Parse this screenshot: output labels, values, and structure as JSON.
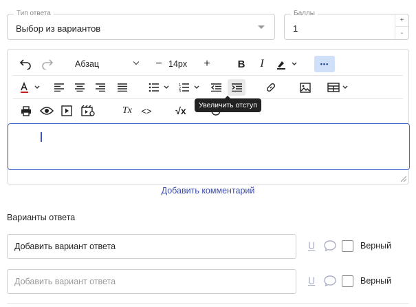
{
  "answer_type": {
    "legend": "Тип ответа",
    "value": "Выбор из вариантов"
  },
  "points": {
    "legend": "Баллы",
    "value": "1",
    "increment": "+",
    "decrement": "-"
  },
  "toolbar": {
    "block_format": "Абзац",
    "font_size": "14px",
    "decrease_size": "−",
    "increase_size": "+",
    "bold": "B",
    "italic": "I",
    "code": "<>",
    "clear_format": "Tx",
    "formula": "√x",
    "more": "•••"
  },
  "tooltip": {
    "text": "Увеличить отступ"
  },
  "editor": {
    "content": ""
  },
  "add_comment": "Добавить комментарий",
  "answers_section": {
    "title": "Варианты ответа",
    "rows": [
      {
        "value": "Добавить вариант ответа",
        "placeholder": "",
        "correct_label": "Верный",
        "underline_icon": "U"
      },
      {
        "value": "",
        "placeholder": "Добавить вариант ответа",
        "correct_label": "Верный",
        "underline_icon": "U"
      }
    ]
  },
  "colors": {
    "accent": "#4a68c8",
    "link": "#3b4bb0",
    "active_button_bg": "#cfe0f8",
    "tooltip_bg": "#222222"
  }
}
